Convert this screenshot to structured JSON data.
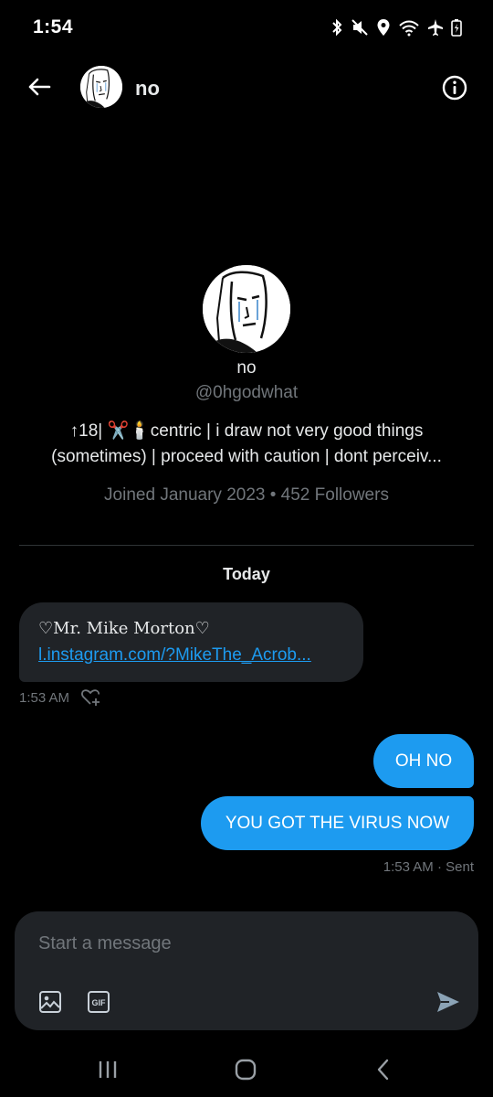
{
  "status_bar": {
    "time": "1:54",
    "icons": [
      "bluetooth-icon",
      "mute-icon",
      "location-icon",
      "wifi-icon",
      "airplane-icon",
      "battery-icon"
    ]
  },
  "header": {
    "name": "no",
    "back_icon": "arrow-left-icon",
    "info_icon": "info-icon"
  },
  "profile": {
    "name": "no",
    "handle": "@0hgodwhat",
    "bio_line_1": "↑18| ✂️🕯️centric | i draw not very good things",
    "bio_line_2": "(sometimes) | proceed with caution | dont perceiv...",
    "meta": "Joined January 2023 • 452 Followers"
  },
  "conversation": {
    "date_label": "Today",
    "received": {
      "text": "♡Mr. Mike Morton♡",
      "link": "l.instagram.com/?MikeThe_Acrob...",
      "time": "1:53 AM"
    },
    "sent": [
      {
        "text": "OH NO"
      },
      {
        "text": "YOU GOT THE VIRUS NOW"
      }
    ],
    "sent_meta": "1:53 AM · Sent"
  },
  "composer": {
    "placeholder": "Start a message",
    "gif_label": "GIF"
  },
  "colors": {
    "background": "#000000",
    "bubble_received": "#202327",
    "bubble_sent": "#1d9bf0",
    "text_primary": "#e7e9ea",
    "text_secondary": "#71767b",
    "link": "#1d9bf0"
  }
}
